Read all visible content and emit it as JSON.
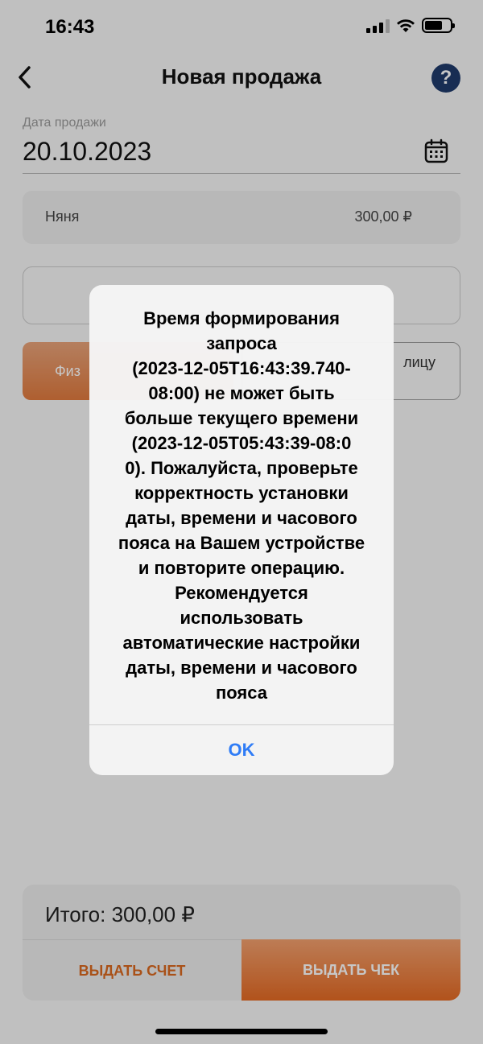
{
  "status_bar": {
    "time": "16:43"
  },
  "nav": {
    "title": "Новая продажа",
    "help_label": "?"
  },
  "sale_date": {
    "label": "Дата продажи",
    "value": "20.10.2023"
  },
  "item": {
    "name": "Няня",
    "price": "300,00 ₽"
  },
  "buyer_type": {
    "left_partial": "Физ",
    "right_partial": "лицу"
  },
  "total": {
    "label": "Итого: 300,00 ₽"
  },
  "actions": {
    "invoice": "ВЫДАТЬ СЧЕТ",
    "receipt": "ВЫДАТЬ ЧЕК"
  },
  "alert": {
    "lines": [
      "Время формирования",
      "запроса",
      "(2023-12-05T16:43:39.740-",
      "08:00) не может быть",
      "больше текущего времени",
      "(2023-12-05T05:43:39-08:0",
      "0). Пожалуйста, проверьте",
      "корректность установки",
      "даты, времени и часового",
      "пояса на Вашем устройстве",
      "и повторите операцию.",
      "Рекомендуется",
      "использовать",
      "автоматические настройки",
      "даты, времени и часового",
      "пояса"
    ],
    "ok_label": "OK"
  },
  "colors": {
    "accent_orange": "#e46a24",
    "help_blue": "#1f3a6b",
    "ios_link_blue": "#2f7cf6"
  }
}
